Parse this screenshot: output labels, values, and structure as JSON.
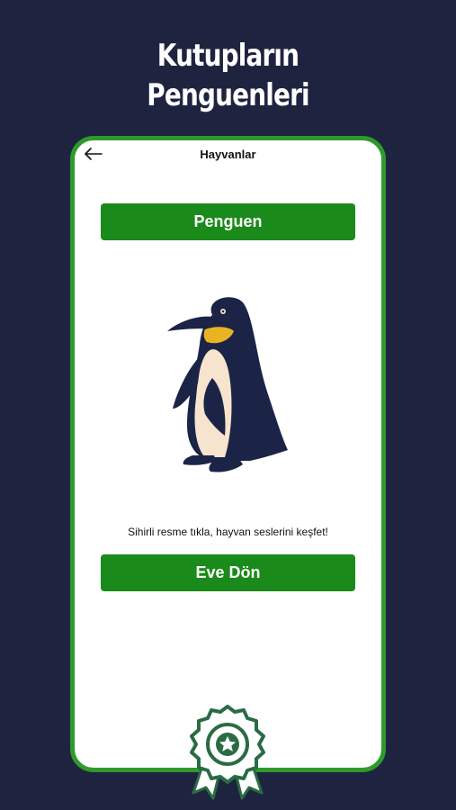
{
  "promo": {
    "title_line1": "Kutupların",
    "title_line2": "Penguenleri"
  },
  "app": {
    "nav": {
      "back_icon": "arrow-left-icon",
      "title": "Hayvanlar"
    },
    "animal_button_label": "Penguen",
    "image": {
      "icon": "penguin-illustration"
    },
    "hint": "Sihirli resme tıkla, hayvan seslerini keşfet!",
    "home_button_label": "Eve Dön"
  },
  "badge": {
    "icon": "award-badge-star-icon"
  },
  "colors": {
    "background": "#1e2440",
    "frame_border": "#2f9a2b",
    "button": "#1a8a1a",
    "badge": "#2a6b45"
  }
}
